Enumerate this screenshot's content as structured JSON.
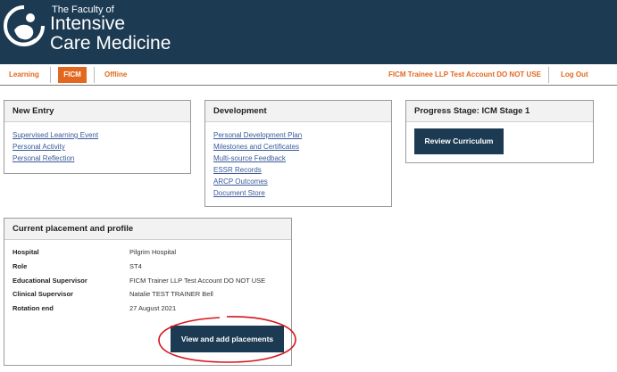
{
  "brand": {
    "line1": "The Faculty of",
    "line2": "Intensive",
    "line3": "Care Medicine",
    "logo_icon": "faculty-logo-icon"
  },
  "nav": {
    "learning": "Learning",
    "ficm": "FICM",
    "offline": "Offline",
    "account": "FICM Trainee LLP Test Account DO NOT USE",
    "logout": "Log Out"
  },
  "new_entry": {
    "title": "New Entry",
    "links": [
      "Supervised Learning Event",
      "Personal Activity",
      "Personal Reflection"
    ]
  },
  "development": {
    "title": "Development",
    "links": [
      "Personal Development Plan",
      "Milestones and Certificates",
      "Multi-source Feedback",
      "ESSR Records",
      "ARCP Outcomes",
      "Document Store"
    ]
  },
  "progress": {
    "title": "Progress Stage: ICM Stage 1",
    "button": "Review Curriculum"
  },
  "placement": {
    "title": "Current placement and profile",
    "rows": [
      {
        "label": "Hospital",
        "value": "Pilgrim Hospital"
      },
      {
        "label": "Role",
        "value": "ST4"
      },
      {
        "label": "Educational Supervisor",
        "value": "FICM Trainer LLP Test Account DO NOT USE"
      },
      {
        "label": "Clinical Supervisor",
        "value": "Natalie TEST TRAINER Bell"
      },
      {
        "label": "Rotation end",
        "value": "27 August 2021"
      }
    ],
    "button": "View and add placements"
  },
  "colors": {
    "header": "#1c3a52",
    "accent": "#e2681f",
    "link": "#3a5a9a",
    "annotation": "#d8141c"
  }
}
